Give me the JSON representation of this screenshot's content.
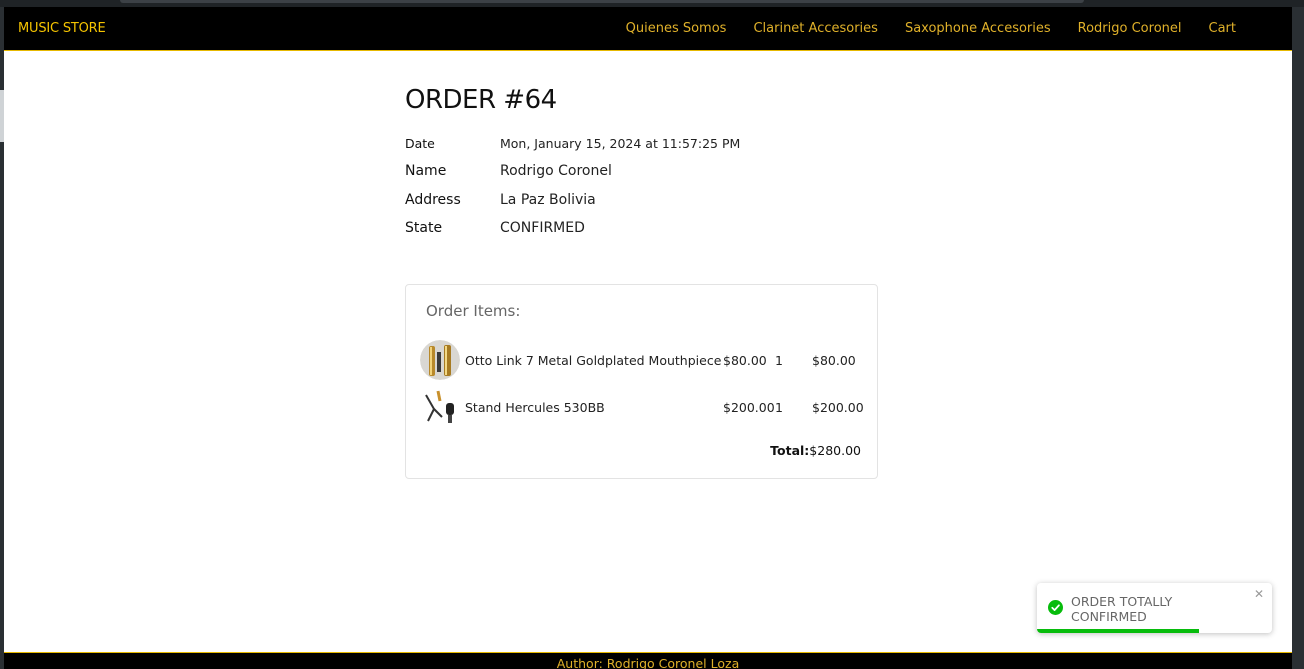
{
  "navbar": {
    "brand": "MUSIC STORE",
    "links": [
      "Quienes Somos",
      "Clarinet Accesories",
      "Saxophone Accesories",
      "Rodrigo Coronel",
      "Cart"
    ]
  },
  "order": {
    "title": "ORDER #64",
    "date_label": "Date",
    "date_value": "Mon, January 15, 2024 at 11:57:25 PM",
    "name_label": "Name",
    "name_value": "Rodrigo Coronel",
    "address_label": "Address",
    "address_value": "La Paz Bolivia",
    "state_label": "State",
    "state_value": "CONFIRMED"
  },
  "items_card": {
    "title": "Order Items:",
    "items": [
      {
        "name": "Otto Link 7 Metal Goldplated Mouthpiece",
        "price": "$80.00",
        "qty": "1",
        "total": "$80.00",
        "thumb": "mouthpiece-image"
      },
      {
        "name": "Stand Hercules 530BB",
        "price": "$200.00",
        "qty": "1",
        "total": "$200.00",
        "thumb": "stand-image"
      }
    ],
    "total_label": "Total:",
    "total_value": "$280.00"
  },
  "footer": {
    "text": "Author: Rodrigo Coronel Loza"
  },
  "toast": {
    "message": "ORDER TOTALLY CONFIRMED",
    "progress": 0.69,
    "icon": "check-circle-icon"
  },
  "colors": {
    "navbar_bg": "#000000",
    "accent": "#e0b12a",
    "brand": "#f5c400",
    "toast_success": "#07bc0c"
  }
}
